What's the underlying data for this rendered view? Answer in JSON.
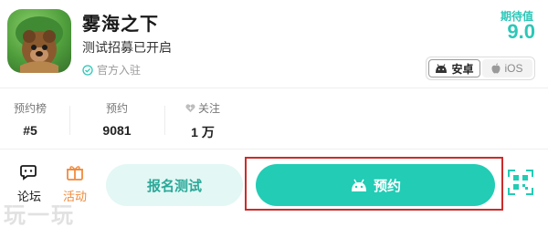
{
  "app": {
    "title": "雾海之下",
    "subtitle": "测试招募已开启",
    "official": "官方入驻"
  },
  "expectation": {
    "label": "期待值",
    "score": "9.0"
  },
  "platforms": [
    {
      "label": "安卓",
      "icon": "android-icon",
      "active": true
    },
    {
      "label": "iOS",
      "icon": "apple-icon",
      "active": false
    }
  ],
  "stats": [
    {
      "label": "预约榜",
      "value": "#5"
    },
    {
      "label": "预约",
      "value": "9081"
    },
    {
      "label": "关注",
      "value": "1 万",
      "icon": "heart-icon"
    }
  ],
  "bottom": {
    "forum": "论坛",
    "activity": "活动",
    "signup_test": "报名测试",
    "reserve": "预约"
  },
  "watermark": "玩一玩",
  "colors": {
    "accent": "#22ccb5",
    "activity": "#f08a3c",
    "highlight": "#cc2b2b"
  }
}
